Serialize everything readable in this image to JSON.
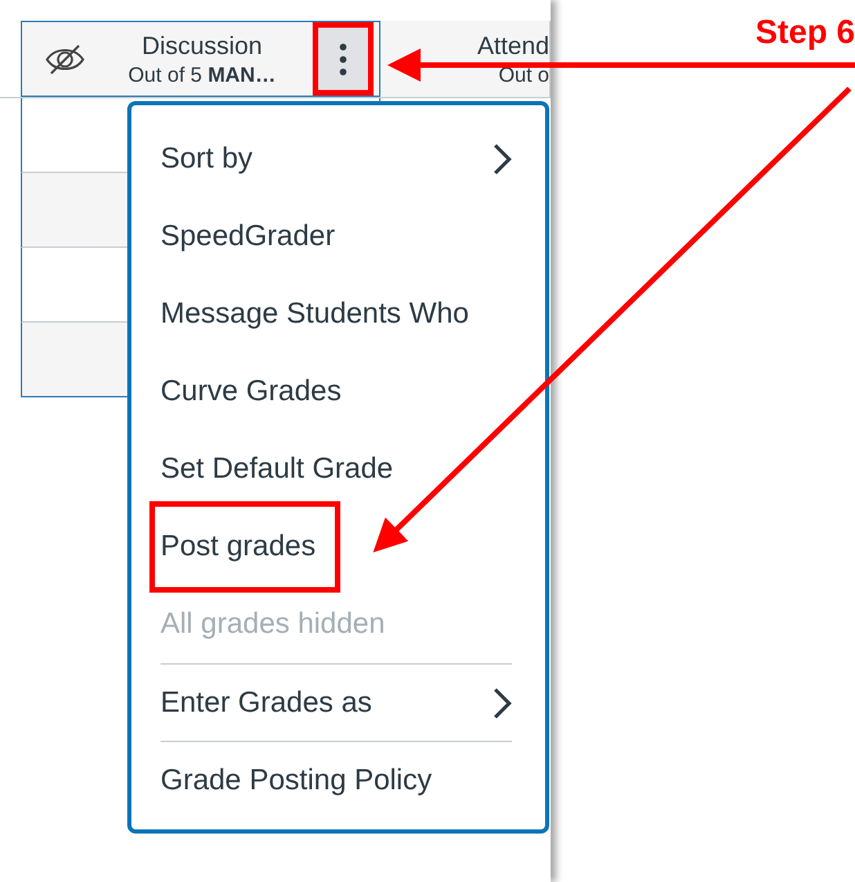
{
  "columns": [
    {
      "title": "Discussion",
      "subtitle": "Out of 5 **MAN…**",
      "grades_hidden": true,
      "menu_open": true
    },
    {
      "title": "Attend",
      "subtitle": "Out o",
      "grades_hidden": false,
      "menu_open": false
    }
  ],
  "menu": {
    "items": [
      {
        "label": "Sort by",
        "kind": "submenu",
        "highlighted": false,
        "divider_before": false
      },
      {
        "label": "SpeedGrader",
        "kind": "item",
        "highlighted": false,
        "divider_before": false
      },
      {
        "label": "Message Students Who",
        "kind": "item",
        "highlighted": false,
        "divider_before": false
      },
      {
        "label": "Curve Grades",
        "kind": "item",
        "highlighted": false,
        "divider_before": false
      },
      {
        "label": "Set Default Grade",
        "kind": "item",
        "highlighted": false,
        "divider_before": false
      },
      {
        "label": "Post grades",
        "kind": "item",
        "highlighted": true,
        "divider_before": false
      },
      {
        "label": "All grades hidden",
        "kind": "disabled",
        "highlighted": false,
        "divider_before": false
      },
      {
        "label": "Enter Grades as",
        "kind": "submenu",
        "highlighted": false,
        "divider_before": true
      },
      {
        "label": "Grade Posting Policy",
        "kind": "item",
        "highlighted": false,
        "divider_before": true
      }
    ]
  },
  "callout": {
    "label": "Step 6"
  }
}
